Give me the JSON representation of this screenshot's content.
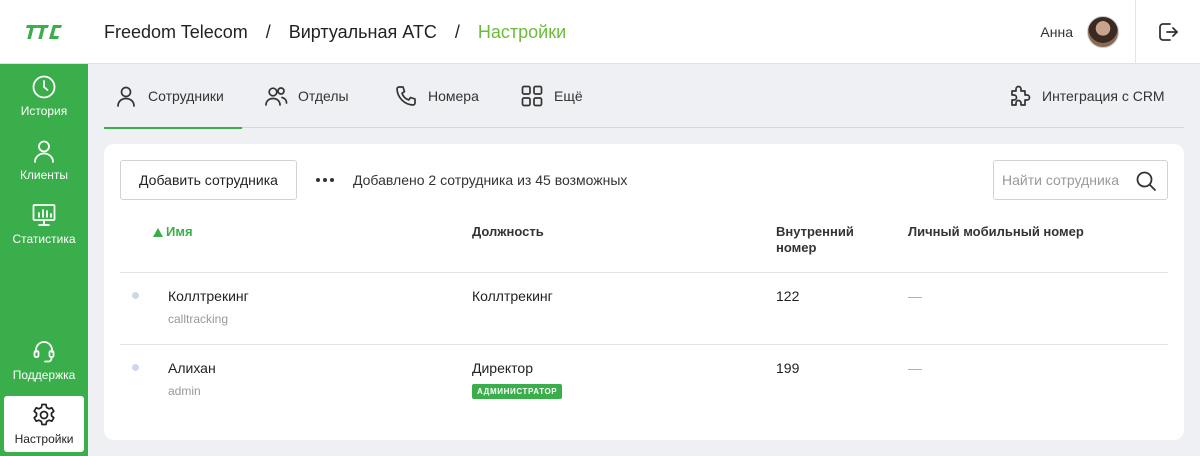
{
  "header": {
    "logo_text": "ПС",
    "breadcrumbs": [
      "Freedom Telecom",
      "Виртуальная АТС",
      "Настройки"
    ],
    "separator": "/",
    "user_name": "Анна"
  },
  "sidebar": {
    "items": [
      {
        "label": "История",
        "icon": "clock-icon"
      },
      {
        "label": "Клиенты",
        "icon": "person-icon"
      },
      {
        "label": "Статистика",
        "icon": "chart-icon"
      },
      {
        "label": "Поддержка",
        "icon": "headset-icon"
      },
      {
        "label": "Настройки",
        "icon": "gear-icon",
        "active": true
      }
    ]
  },
  "tabs": {
    "items": [
      {
        "label": "Сотрудники",
        "icon": "person-icon",
        "active": true
      },
      {
        "label": "Отделы",
        "icon": "group-icon"
      },
      {
        "label": "Номера",
        "icon": "phone-icon"
      },
      {
        "label": "Ещё",
        "icon": "grid-icon"
      }
    ],
    "crm": {
      "label": "Интеграция с CRM",
      "icon": "puzzle-icon"
    }
  },
  "toolbar": {
    "add_label": "Добавить сотрудника",
    "info_text": "Добавлено 2 сотрудника из 45 возможных",
    "search_placeholder": "Найти сотрудника"
  },
  "table": {
    "columns": {
      "name": "Имя",
      "position": "Должность",
      "ext_line1": "Внутренний",
      "ext_line2": "номер",
      "mobile": "Личный мобильный номер"
    },
    "rows": [
      {
        "name": "Коллтрекинг",
        "login": "calltracking",
        "position": "Коллтрекинг",
        "badge": "",
        "ext": "122",
        "mobile": "—"
      },
      {
        "name": "Алихан",
        "login": "admin",
        "position": "Директор",
        "badge": "АДМИНИСТРАТОР",
        "ext": "199",
        "mobile": "—"
      }
    ]
  },
  "colors": {
    "brand_green": "#3aae4a",
    "breadcrumb_active": "#6cbb3c"
  }
}
